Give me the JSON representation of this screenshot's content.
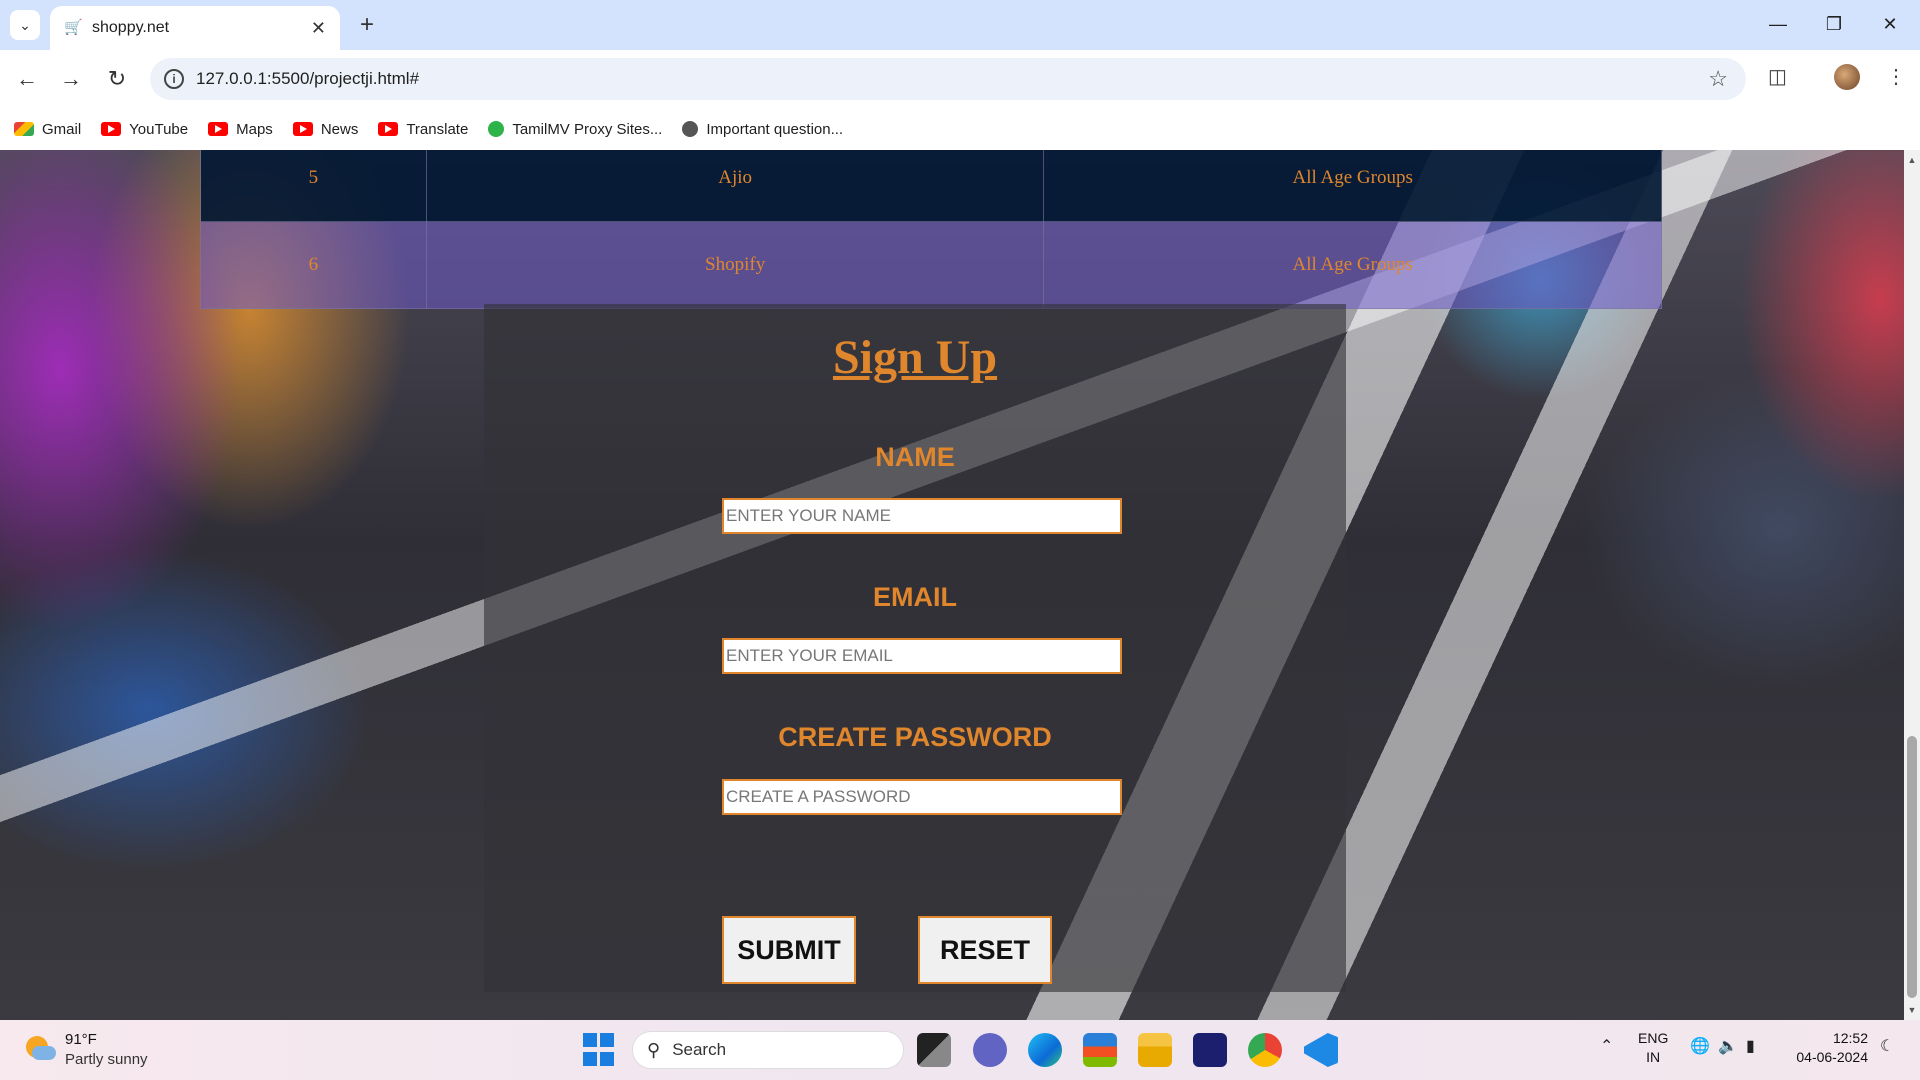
{
  "browser": {
    "tab_title": "shoppy.net",
    "url": "127.0.0.1:5500/projectji.html#",
    "bookmarks": [
      {
        "label": "Gmail",
        "icon": "gmail-icon"
      },
      {
        "label": "YouTube",
        "icon": "youtube-icon"
      },
      {
        "label": "Maps",
        "icon": "youtube-icon"
      },
      {
        "label": "News",
        "icon": "youtube-icon"
      },
      {
        "label": "Translate",
        "icon": "youtube-icon"
      },
      {
        "label": "TamilMV Proxy Sites...",
        "icon": "tamilmv-icon"
      },
      {
        "label": "Important question...",
        "icon": "globe-icon"
      }
    ]
  },
  "table": {
    "rows": [
      {
        "num": "5",
        "name": "Ajio",
        "age": "All Age Groups"
      },
      {
        "num": "6",
        "name": "Shopify",
        "age": "All Age Groups"
      }
    ]
  },
  "form": {
    "title": "Sign Up",
    "name_label": "NAME",
    "name_placeholder": "ENTER YOUR NAME",
    "email_label": "EMAIL",
    "email_placeholder": "ENTER YOUR EMAIL",
    "password_label": "CREATE PASSWORD",
    "password_placeholder": "CREATE A PASSWORD",
    "submit_label": "SUBMIT",
    "reset_label": "RESET",
    "accent_color": "#e0862c"
  },
  "taskbar": {
    "temperature": "91°F",
    "condition": "Partly sunny",
    "search_label": "Search",
    "lang_line1": "ENG",
    "lang_line2": "IN",
    "time": "12:52",
    "date": "04-06-2024"
  }
}
